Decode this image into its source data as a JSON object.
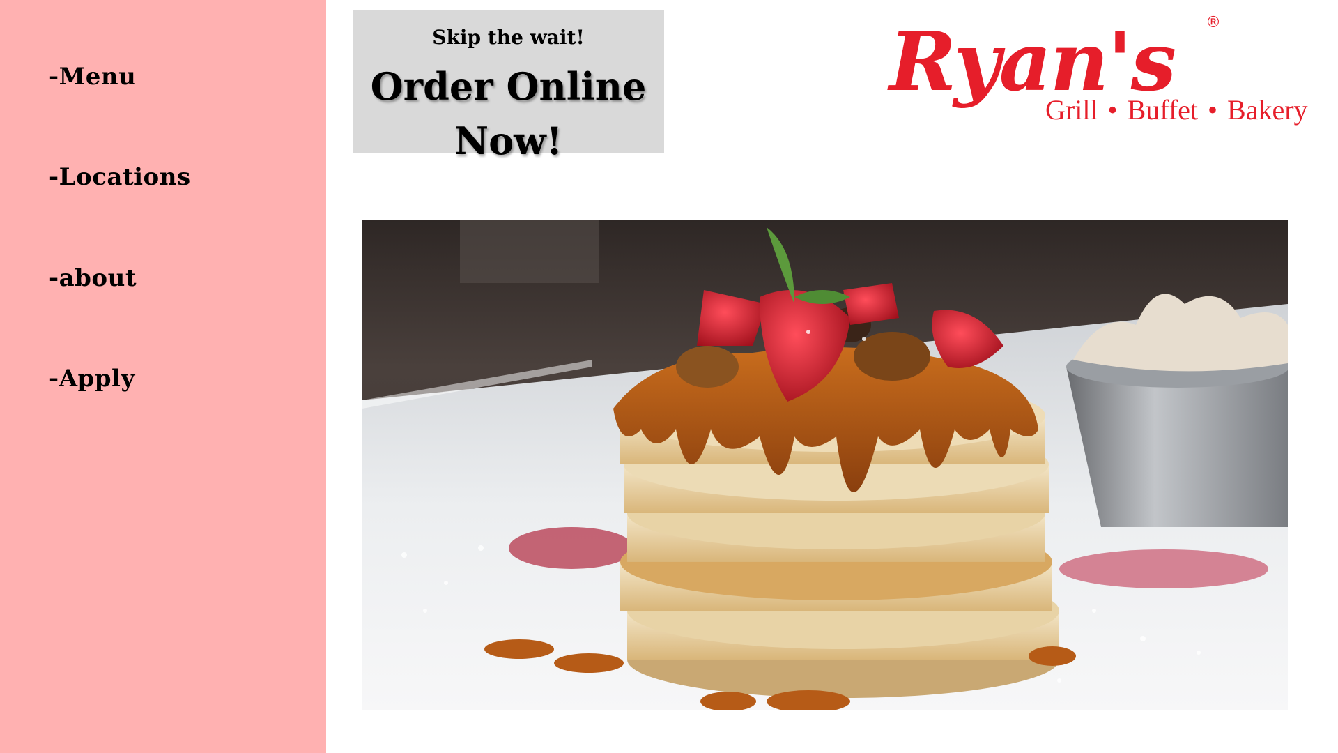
{
  "sidebar": {
    "background": "#ffb1b1",
    "items": [
      {
        "label": "-Menu"
      },
      {
        "label": "-Locations"
      },
      {
        "label": "-about"
      },
      {
        "label": "-Apply"
      }
    ]
  },
  "order_banner": {
    "subtitle": "Skip the wait!",
    "title_line1": "Order Online",
    "title_line2": "Now!"
  },
  "logo": {
    "name": "Ryan's",
    "registered": "®",
    "tagline": [
      "Grill",
      "Buffet",
      "Bakery"
    ],
    "separator": "•",
    "brand_color": "#e61e2a"
  },
  "hero": {
    "subject": "pancake-stack-image"
  }
}
